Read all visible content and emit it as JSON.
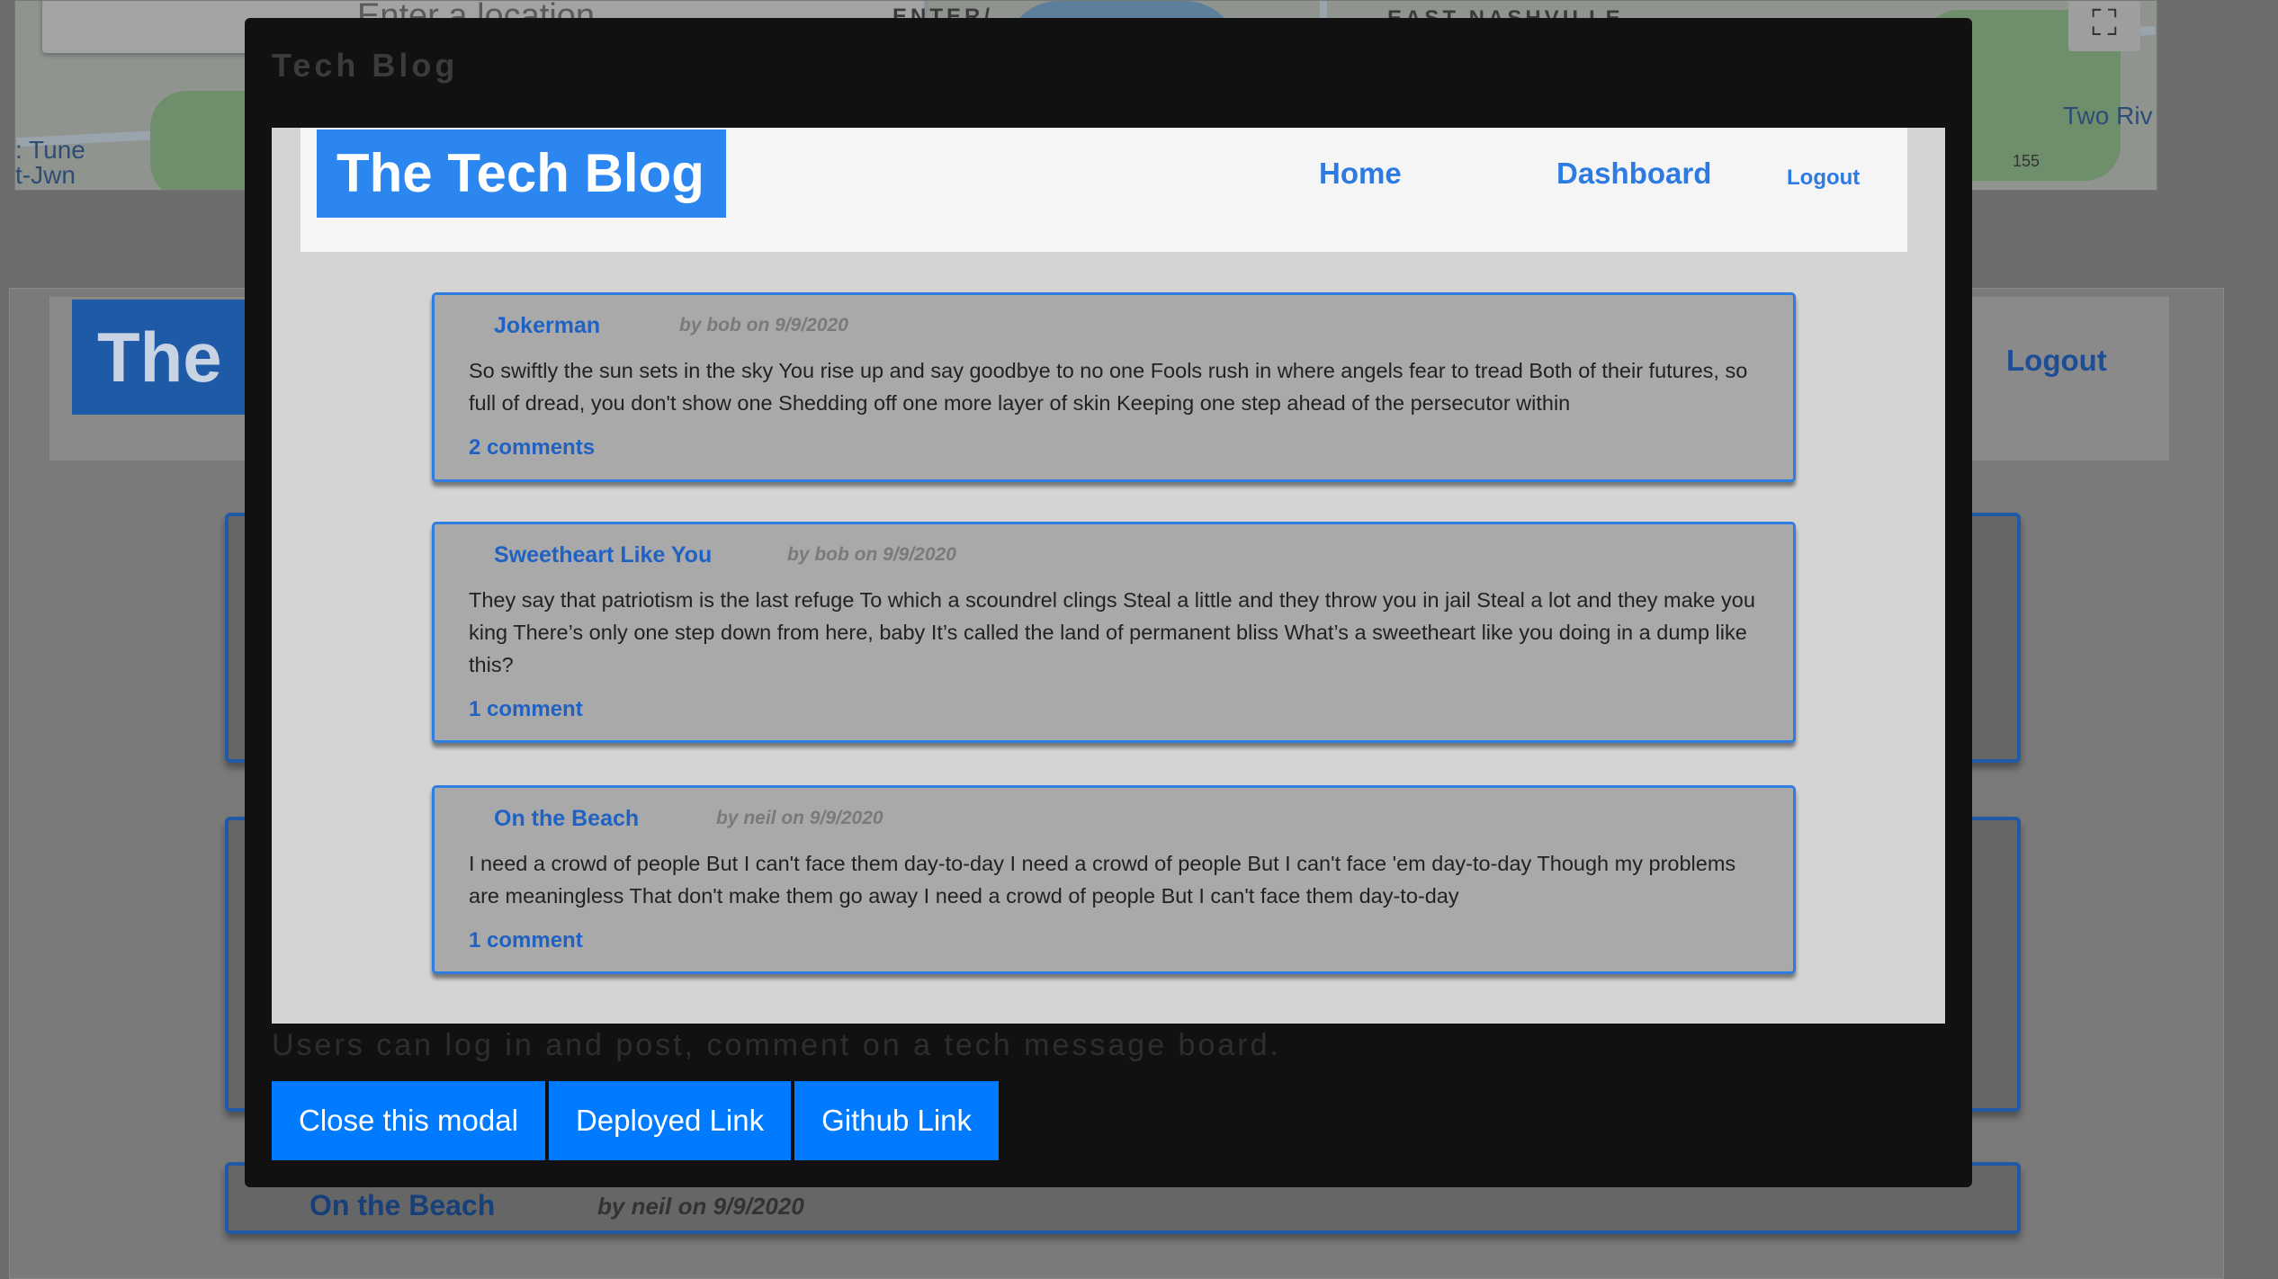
{
  "background": {
    "map": {
      "search_placeholder": "Enter a location",
      "labels": [
        "ENTER/",
        "EAST NASHVILLE",
        "Two Riv",
        ": Tune",
        "t-Jwn",
        "155"
      ],
      "fullscreen_icon": "fullscreen-icon"
    },
    "brand": "The",
    "logout": "Logout",
    "last_card": {
      "title": "On the Beach",
      "meta": "by neil on 9/9/2020"
    }
  },
  "modal": {
    "title": "Tech Blog",
    "description": "Users can log in and post, comment on a tech message board.",
    "buttons": {
      "close": "Close this modal",
      "deployed": "Deployed Link",
      "github": "Github Link"
    },
    "colors": {
      "accent": "#007bff",
      "overlay": "#111111"
    }
  },
  "preview": {
    "brand": "The Tech Blog",
    "nav": {
      "home": "Home",
      "dashboard": "Dashboard",
      "logout": "Logout"
    },
    "posts": [
      {
        "title": "Jokerman",
        "meta": "by bob on 9/9/2020",
        "body": "So swiftly the sun sets in the sky You rise up and say goodbye to no one Fools rush in where angels fear to tread Both of their futures, so full of dread, you don't show one Shedding off one more layer of skin Keeping one step ahead of the persecutor within",
        "comments": "2 comments"
      },
      {
        "title": "Sweetheart Like You",
        "meta": "by bob on 9/9/2020",
        "body": "They say that patriotism is the last refuge To which a scoundrel clings Steal a little and they throw you in jail Steal a lot and they make you king There’s only one step down from here, baby It’s called the land of permanent bliss What’s a sweetheart like you doing in a dump like this?",
        "comments": "1 comment"
      },
      {
        "title": "On the Beach",
        "meta": "by neil on 9/9/2020",
        "body": "I need a crowd of people But I can't face them day-to-day I need a crowd of people But I can't face 'em day-to-day Though my problems are meaningless That don't make them go away I need a crowd of people But I can't face them day-to-day",
        "comments": "1 comment"
      }
    ],
    "colors": {
      "brand": "#2c86f0",
      "link": "#2d7be0",
      "card_border": "#2f7de1"
    }
  }
}
